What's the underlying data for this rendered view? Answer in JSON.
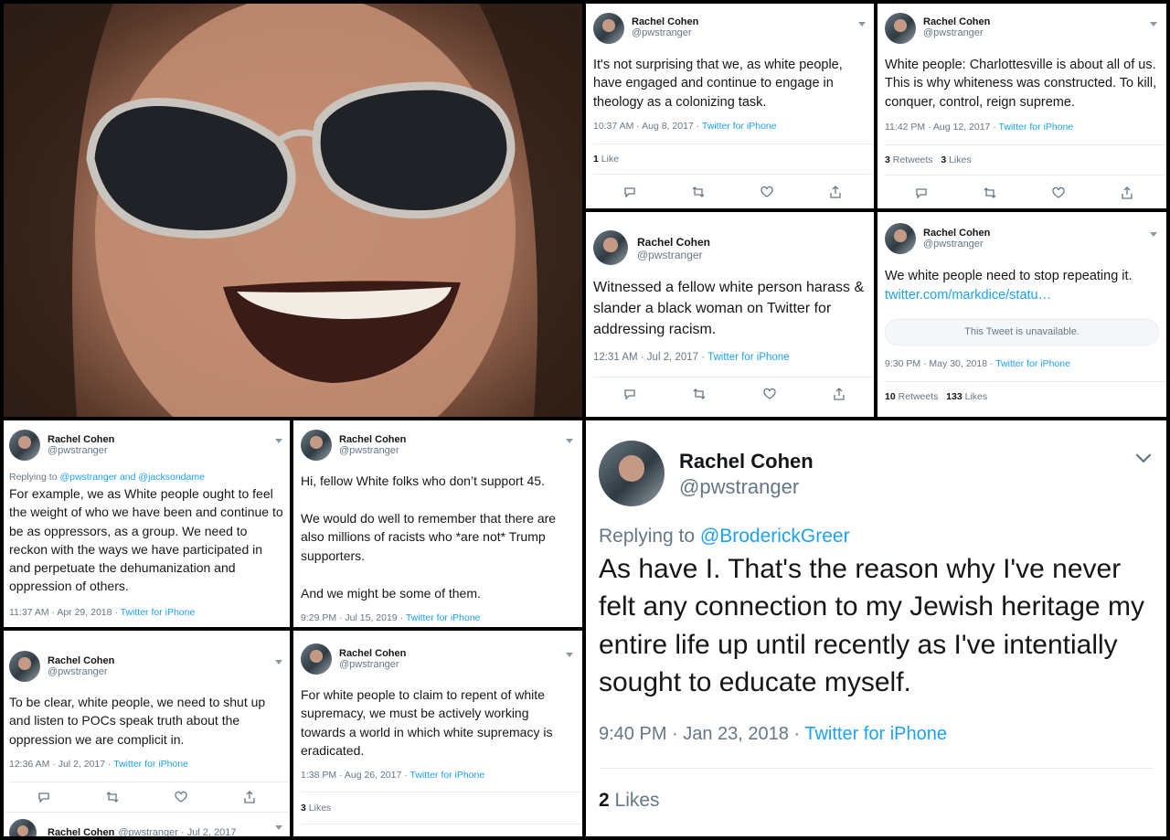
{
  "user": {
    "name": "Rachel Cohen",
    "handle": "@pwstranger"
  },
  "tweets": [
    {
      "text": "It's not surprising that we, as white people, have engaged and continue to engage in theology as a colonizing task.",
      "time": "10:37 AM · Aug 8, 2017",
      "source": "Twitter for iPhone",
      "stats": [
        {
          "count": "1",
          "label": "Like"
        }
      ]
    },
    {
      "text": "White people: Charlottesville is about all of us. This is why whiteness was constructed. To kill, conquer, control, reign supreme.",
      "time": "11:42 PM · Aug 12, 2017",
      "source": "Twitter for iPhone",
      "stats": [
        {
          "count": "3",
          "label": "Retweets"
        },
        {
          "count": "3",
          "label": "Likes"
        }
      ]
    },
    {
      "text": "Witnessed a fellow white person harass & slander a black woman on Twitter for addressing racism.",
      "time": "12:31 AM · Jul 2, 2017",
      "source": "Twitter for iPhone"
    },
    {
      "text": "We white people need to stop repeating it.",
      "link": "twitter.com/markdice/statu…",
      "quote": "This Tweet is unavailable.",
      "time": "9:30 PM · May 30, 2018",
      "source": "Twitter for iPhone",
      "stats": [
        {
          "count": "10",
          "label": "Retweets"
        },
        {
          "count": "133",
          "label": "Likes"
        }
      ]
    },
    {
      "replying": "Replying to",
      "mentions": "@pwstranger and @jacksondame",
      "text": "For example, we as White people ought to feel the weight of who we have been and continue to be as oppressors, as a group. We need to reckon with the ways we have participated in and perpetuate the dehumanization and oppression of others.",
      "time": "11:37 AM · Apr 29, 2018",
      "source": "Twitter for iPhone"
    },
    {
      "text1": "Hi, fellow White folks who don’t support 45.",
      "text2": "We would do well to remember that there are also millions of racists who *are not* Trump supporters.",
      "text3": "And we might be some of them.",
      "time": "9:29 PM · Jul 15, 2019",
      "source": "Twitter for iPhone"
    },
    {
      "replying": "Replying to",
      "mentions": "@BroderickGreer",
      "text": "As have I. That's the reason why I've never felt any connection to my Jewish heritage my entire life up until recently as I've intentially sought to educate myself.",
      "time": "9:40 PM · Jan 23, 2018",
      "source": "Twitter for iPhone",
      "stats": [
        {
          "count": "2",
          "label": "Likes"
        }
      ]
    },
    {
      "text": "To be clear, white people, we need to shut up and listen to POCs speak truth about the oppression we are complicit in.",
      "time": "12:36 AM · Jul 2, 2017",
      "source": "Twitter for iPhone",
      "next": {
        "name": "Rachel Cohen",
        "handle": "@pwstranger · Jul 2, 2017"
      }
    },
    {
      "text": "For white people to claim to repent of white supremacy, we must be actively working towards a world in which white supremacy is eradicated.",
      "time": "1:38 PM · Aug 26, 2017",
      "source": "Twitter for iPhone",
      "stats": [
        {
          "count": "3",
          "label": "Likes"
        }
      ]
    }
  ],
  "icons": [
    "reply-icon",
    "retweet-icon",
    "like-icon",
    "share-icon",
    "chevron-down-icon"
  ],
  "colors": {
    "link": "#1da1f2",
    "muted": "#657786",
    "text": "#14171a",
    "border": "#e6ecf0"
  }
}
